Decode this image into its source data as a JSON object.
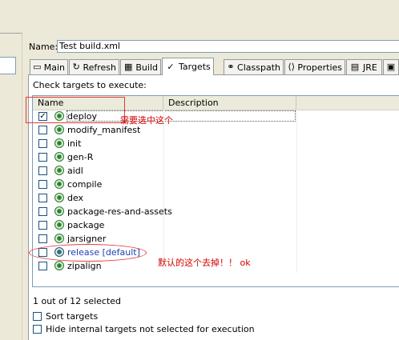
{
  "name_field": {
    "label": "Name:",
    "value": "Test build.xml"
  },
  "tabs": [
    {
      "label": "Main",
      "icon": "main-icon"
    },
    {
      "label": "Refresh",
      "icon": "refresh-icon"
    },
    {
      "label": "Build",
      "icon": "build-icon"
    },
    {
      "label": "Targets",
      "icon": "targets-icon",
      "active": true
    },
    {
      "label": "Classpath",
      "icon": "classpath-icon"
    },
    {
      "label": "Properties",
      "icon": "properties-icon"
    },
    {
      "label": "JRE",
      "icon": "jre-icon"
    }
  ],
  "targets_panel": {
    "instruction": "Check targets to execute:",
    "columns": {
      "name": "Name",
      "description": "Description"
    },
    "rows": [
      {
        "name": "deploy",
        "checked": true
      },
      {
        "name": "modify_manifest",
        "checked": false
      },
      {
        "name": "init",
        "checked": false
      },
      {
        "name": "gen-R",
        "checked": false
      },
      {
        "name": "aidl",
        "checked": false
      },
      {
        "name": "compile",
        "checked": false
      },
      {
        "name": "dex",
        "checked": false
      },
      {
        "name": "package-res-and-assets",
        "checked": false
      },
      {
        "name": "package",
        "checked": false
      },
      {
        "name": "jarsigner",
        "checked": false
      },
      {
        "name": "release [default]",
        "checked": false,
        "default": true
      },
      {
        "name": "zipalign",
        "checked": false
      }
    ],
    "status": "1 out of 12 selected",
    "sort_targets": {
      "label": "Sort targets",
      "checked": false
    },
    "hide_internal": {
      "label": "Hide internal targets not selected for execution",
      "checked": false
    }
  },
  "annotations": {
    "note_select": "需要选中这个",
    "note_default": "默认的这个去掉！！ ok",
    "color": "#d40000"
  }
}
